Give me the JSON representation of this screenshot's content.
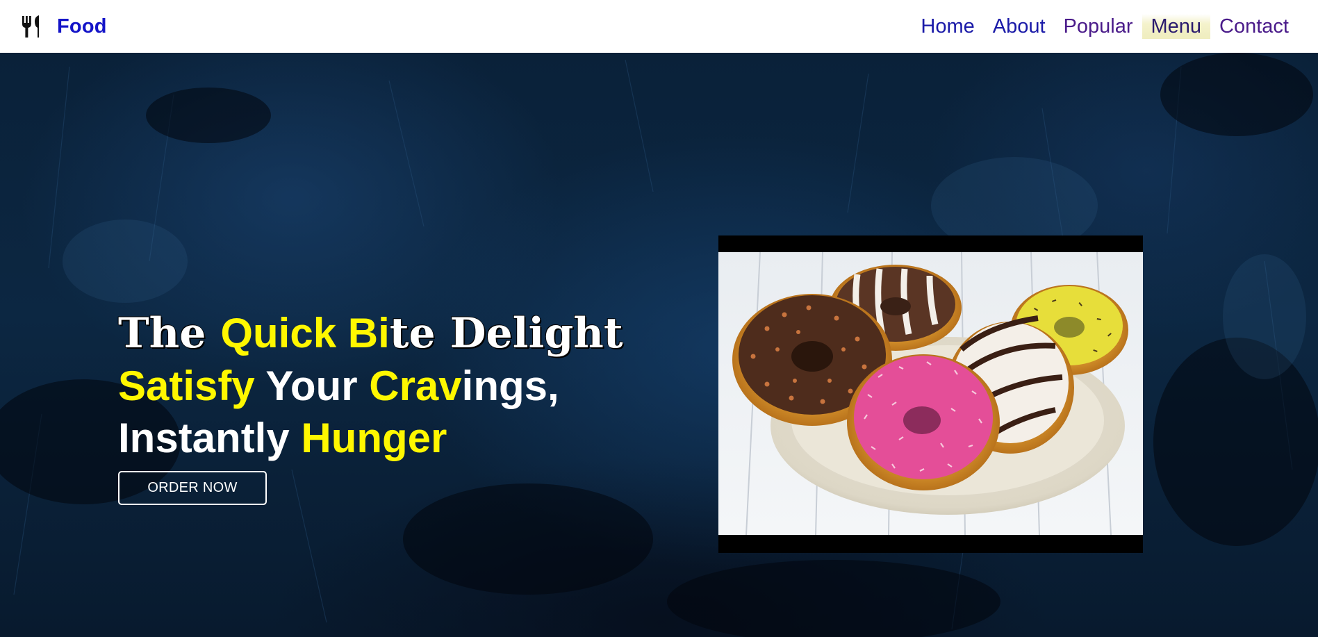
{
  "brand": {
    "icon": "fork-knife-icon",
    "name": "Food"
  },
  "nav": {
    "items": [
      {
        "label": "Home"
      },
      {
        "label": "About"
      },
      {
        "label": "Popular"
      },
      {
        "label": "Menu"
      },
      {
        "label": "Contact"
      }
    ]
  },
  "hero": {
    "line1": {
      "part1": "The ",
      "part2": "Quick Bi",
      "part3": "te Delight"
    },
    "line2": {
      "part1": "Satisfy",
      "part2": " Your ",
      "part3": "Crav",
      "part4": "ings,"
    },
    "line3": {
      "part1": "Instantly ",
      "part2": "Hunger"
    },
    "cta_label": "ORDER NOW",
    "image": "donuts-on-plate-image"
  },
  "colors": {
    "brand": "#1414c8",
    "nav_blue": "#1a1aa8",
    "nav_purple": "#4a1b8a",
    "accent_yellow": "#fff700",
    "hero_bg": "#0c2742",
    "menu_highlight": "#efedbe"
  }
}
